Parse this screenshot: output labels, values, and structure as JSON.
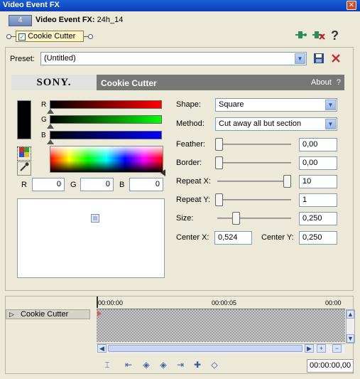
{
  "window": {
    "title": "Video Event FX",
    "close_icon": "close-icon"
  },
  "header": {
    "badge": "4",
    "label": "Video Event FX:",
    "event_name": "24h_14"
  },
  "chain": {
    "plugin_label": "Cookie Cutter",
    "enabled": true
  },
  "toolbar": {
    "icons": [
      "plugin-chain-icon",
      "remove-plugin-icon",
      "help-icon"
    ],
    "help_glyph": "?"
  },
  "preset": {
    "label": "Preset:",
    "value": "(Untitled)"
  },
  "banner": {
    "logo": "SONY.",
    "plugin": "Cookie Cutter",
    "about": "About",
    "help": "?"
  },
  "color": {
    "r_label": "R",
    "g_label": "G",
    "b_label": "B",
    "r_value": "0",
    "g_value": "0",
    "b_value": "0",
    "swatch": "#000000"
  },
  "props": {
    "shape_label": "Shape:",
    "shape_value": "Square",
    "method_label": "Method:",
    "method_value": "Cut away all but section",
    "feather_label": "Feather:",
    "feather_value": "0,00",
    "feather_level": 0.0,
    "border_label": "Border:",
    "border_value": "0,00",
    "border_level": 0.0,
    "repeat_x_label": "Repeat X:",
    "repeat_x_value": "10",
    "repeat_x_level": 1.0,
    "repeat_y_label": "Repeat Y:",
    "repeat_y_value": "1",
    "repeat_y_level": 0.0,
    "size_label": "Size:",
    "size_value": "0,250",
    "size_level": 0.25,
    "center_x_label": "Center X:",
    "center_x_value": "0,524",
    "center_y_label": "Center Y:",
    "center_y_value": "0,250"
  },
  "timeline": {
    "track": "Cookie Cutter",
    "ruler": [
      "00:00:00",
      "00:00:05",
      "00:00"
    ],
    "time": "00:00:00,00"
  }
}
